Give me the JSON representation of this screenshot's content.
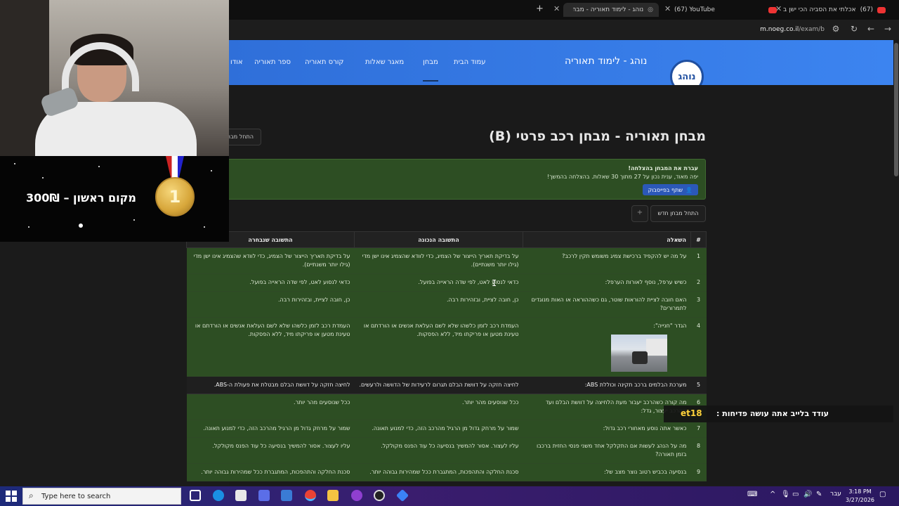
{
  "browser": {
    "tabs": [
      {
        "title": "אכלתי את הסביה הכי ישן ב",
        "prefix": "(67)"
      },
      {
        "title": "(67) YouTube"
      },
      {
        "title": "נוהג - לימוד תאוריה - מבחן תאו",
        "active": true
      }
    ],
    "url_domain": "m.noeg.co.il",
    "url_path": "/exam/b"
  },
  "site": {
    "logo_text": "נוהג",
    "brand": "נוהג - לימוד תאוריה",
    "nav": [
      "עמוד הבית",
      "מבחן",
      "מאגר שאלות",
      "קורס תאוריה",
      "ספר תאוריה",
      "אודו"
    ]
  },
  "page": {
    "title": "מבחן תאוריה - מבחן רכב פרטי (B)",
    "start_exam_top": "התחל מבח",
    "success": {
      "title": "עברת את המבחן בהצלחה!",
      "text": "יפה מאוד, ענית נכון על 27 מתוך 30 שאלות. בהצלחה בהמשך!",
      "share": "שתף בפייסבוק"
    },
    "new_exam": "התחל מבחן חדש",
    "new_exam_plus": "+"
  },
  "table": {
    "headers": [
      "#",
      "השאלה",
      "התשובה הנכונה",
      "התשובה שנבחרה"
    ],
    "rows": [
      {
        "n": "1",
        "q": "על מה יש להקפיד ברכישת צמיג משומש תקין לרכב?",
        "a": "על בדיקת תאריך הייצור של הצמיג, כדי לוודא שהצמיג אינו ישן מדי (גילו יותר משנתיים).",
        "s": "על בדיקת תאריך הייצור של הצמיג, כדי לוודא שהצמיג אינו ישן מדי (גילו יותר משנתיים).",
        "ok": true
      },
      {
        "n": "2",
        "q": "כשיש ערפל, נוסף לאורות הערפל:",
        "a": "כדאי לנסוע לאט, לפי שדה הראייה בפועל.",
        "s": "כדאי לנסוע לאט, לפי שדה הראייה בפועל.",
        "ok": true
      },
      {
        "n": "3",
        "q": "האם חובה לציית להוראות שוטר, גם כשההוראה או האות מנוגדים לתמרורים?",
        "a": "כן, חובה לציית, ובזהירות רבה.",
        "s": "כן, חובה לציית, ובזהירות רבה.",
        "ok": true
      },
      {
        "n": "4",
        "q": "הגדר \"חנייה\":",
        "a": "העמדת רכב לזמן כלשהו שלא לשם העלאת אנשים או הורדתם או טעינת מטען או פריקתו מיד, ללא הפסקות.",
        "s": "העמדת רכב לזמן כלשהו שלא לשם העלאת אנשים או הורדתם או טעינת מטען או פריקתו מיד, ללא הפסקות.",
        "ok": true,
        "img": true
      },
      {
        "n": "5",
        "q": "מערכת הבלמים ברכב תקינה וכוללת ABS:",
        "a": "לחיצה חזקה על דוושת הבלם תגרום לרעידות של הדוושה ולרעשים.",
        "s": "לחיצה חזקה על דוושת הבלם מבטלת את פעולת ה-ABS.",
        "ok": false
      },
      {
        "n": "6",
        "q": "מה קורה כשהרכב יעבור מעת הלחיצה על דוושת הבלם ועד שהרכב יעצור, גדל:",
        "a": "ככל שנוסעים מהר יותר.",
        "s": "ככל שנוסעים מהר יותר.",
        "ok": true
      },
      {
        "n": "7",
        "q": "כאשר אתה נוסע מאחורי רכב גדול:",
        "a": "שמור על מרחק גדול מן הרגיל מהרכב הזה, כדי למנוע תאונה.",
        "s": "שמור על מרחק גדול מן הרגיל מהרכב הזה, כדי למנוע תאונה.",
        "ok": true
      },
      {
        "n": "8",
        "q": "מה על הנהג לעשות אם התקלקל אחד משני פנסי החזית ברכבו בזמן תאורה?",
        "a": "עליו לעצור. אסור להמשיך בנסיעה כל עוד הפנס מקולקל.",
        "s": "עליו לעצור. אסור להמשיך בנסיעה כל עוד הפנס מקולקל.",
        "ok": true
      },
      {
        "n": "9",
        "q": "בנסיעה בכביש רטוב נוצר מצב של:",
        "a": "סכנת החלקה והתהפכות, המתגברת ככל שמהירות גבוהה יותר.",
        "s": "סכנת החלקה והתהפכות, המתגברת ככל שמהירות גבוהה יותר.",
        "ok": true
      }
    ]
  },
  "stream": {
    "badge_text": "מקום ראשון – 300₪",
    "medal_label": "1",
    "ticker_text": "עודד בלייב אתה עושה פדיחות :",
    "ticker_tag": "et18"
  },
  "taskbar": {
    "search_placeholder": "Type here to search",
    "lang": "עבר",
    "time": "3:18 PM",
    "date": "3/27/2026"
  },
  "colors": {
    "header_blue": "#3c84f0",
    "success_green": "#2d4e23",
    "share_blue": "#2b58b8"
  }
}
